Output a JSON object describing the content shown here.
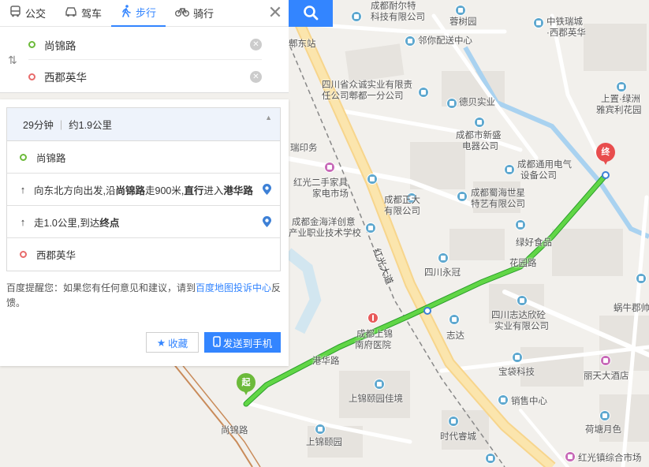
{
  "tabs": [
    {
      "label": "公交",
      "icon": "bus-icon"
    },
    {
      "label": "驾车",
      "icon": "car-icon"
    },
    {
      "label": "步行",
      "icon": "walk-icon",
      "active": true
    },
    {
      "label": "骑行",
      "icon": "bike-icon"
    }
  ],
  "route": {
    "origin": "尚锦路",
    "destination": "西郡英华"
  },
  "summary": {
    "duration": "29分钟",
    "distance": "约1.9公里"
  },
  "steps": {
    "start": "尚锦路",
    "step1": {
      "prefix": "向东北方向出发,沿",
      "road1": "尚锦路",
      "mid": "走900米,",
      "action": "直行",
      "mid2": "进入",
      "road2": "港华路"
    },
    "step2": {
      "prefix": "走1.0公里,到达",
      "target": "终点"
    },
    "end": "西郡英华"
  },
  "tip": {
    "prefix": "百度提醒您：如果您有任何意见和建议，请到",
    "link": "百度地图投诉中心",
    "suffix": "反馈。"
  },
  "buttons": {
    "favorite": "收藏",
    "send": "发送到手机"
  },
  "markers": {
    "start": "起",
    "end": "终"
  },
  "map_labels": {
    "l1": "成都耐尔特",
    "l2": "科技有限公司",
    "l3": "蓉树园",
    "l4": "中铁瑞城",
    "l5": "·西郡英华",
    "l6": "邻你配送中心",
    "l7": "郫东站",
    "l8": "四川省众诚实业有限责",
    "l9": "任公司郫都一分公司",
    "l10": "德贝实业",
    "l11": "上置·绿洲",
    "l12": "雅宾利花园",
    "l13": "成都市新盛",
    "l14": "电器公司",
    "l15": "瑞印务",
    "l16": "成都通用电气",
    "l17": "设备公司",
    "l18": "红光二手家具",
    "l19": "家电市场",
    "l20": "成都正大",
    "l21": "有限公司",
    "l22": "成都蜀海世星",
    "l23": "特艺有限公司",
    "l24": "成都金海洋创意",
    "l25": "产业职业技术学校",
    "l26": "绿好食品",
    "l27": "红光大道",
    "l28": "四川永冠",
    "l29": "花园路",
    "l30": "蜗牛郡帅",
    "l31": "四川志达欣砼",
    "l32": "实业有限公司",
    "l33": "成都上锦",
    "l34": "南府医院",
    "l35": "志达",
    "l36": "港华路",
    "l37": "宝袋科技",
    "l38": "丽天大酒店",
    "l39": "上锦颐园佳境",
    "l40": "销售中心",
    "l41": "荷塘月色",
    "l42": "尚锦路",
    "l43": "上锦颐园",
    "l44": "时代睿城",
    "l45": "红光镇综合市场"
  }
}
